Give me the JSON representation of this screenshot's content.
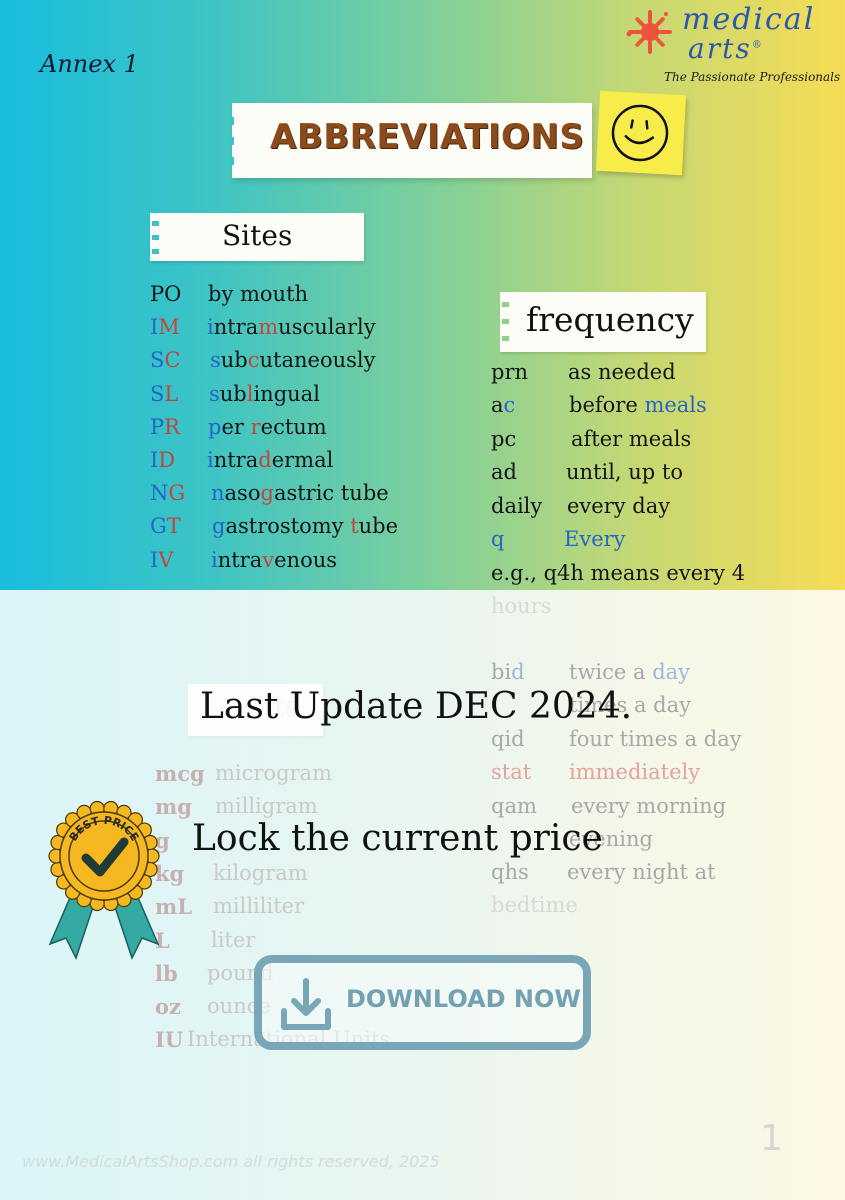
{
  "header": {
    "annex": "Annex 1",
    "title": "ABBREVIATIONS",
    "smiley_icon": "smiley-sticky-note"
  },
  "logo": {
    "line1": "medical",
    "line2": "arts",
    "registered": "®",
    "tagline": "The Passionate Professionals"
  },
  "sites": {
    "heading": "Sites",
    "items": [
      {
        "abbr": [
          [
            "PO",
            ""
          ]
        ],
        "def": [
          [
            "by mouth",
            ""
          ]
        ]
      },
      {
        "abbr": [
          [
            "I",
            "b"
          ],
          [
            "M",
            "r"
          ]
        ],
        "def": [
          [
            "i",
            "b"
          ],
          [
            "ntra",
            ""
          ],
          [
            "m",
            "r"
          ],
          [
            "uscularly",
            ""
          ]
        ]
      },
      {
        "abbr": [
          [
            "S",
            "b"
          ],
          [
            "C",
            "r"
          ]
        ],
        "def": [
          [
            "s",
            "b"
          ],
          [
            "ub",
            ""
          ],
          [
            "c",
            "r"
          ],
          [
            "utaneously",
            ""
          ]
        ]
      },
      {
        "abbr": [
          [
            "S",
            "b"
          ],
          [
            "L",
            "r"
          ]
        ],
        "def": [
          [
            "s",
            "b"
          ],
          [
            "ub",
            ""
          ],
          [
            "l",
            "r"
          ],
          [
            "ingual",
            ""
          ]
        ]
      },
      {
        "abbr": [
          [
            "P",
            "b"
          ],
          [
            "R",
            "r"
          ]
        ],
        "def": [
          [
            "p",
            "b"
          ],
          [
            "er ",
            ""
          ],
          [
            "r",
            "r"
          ],
          [
            "ectum",
            ""
          ]
        ]
      },
      {
        "abbr": [
          [
            "I",
            "b"
          ],
          [
            "D",
            "r"
          ]
        ],
        "def": [
          [
            "i",
            "b"
          ],
          [
            "ntra",
            ""
          ],
          [
            "d",
            "r"
          ],
          [
            "ermal",
            ""
          ]
        ]
      },
      {
        "abbr": [
          [
            "N",
            "b"
          ],
          [
            "G",
            "r"
          ]
        ],
        "def": [
          [
            "n",
            "b"
          ],
          [
            "aso",
            ""
          ],
          [
            "g",
            "r"
          ],
          [
            "astric tube",
            ""
          ]
        ]
      },
      {
        "abbr": [
          [
            "G",
            "b"
          ],
          [
            "T",
            "r"
          ]
        ],
        "def": [
          [
            "g",
            "b"
          ],
          [
            "astrostomy ",
            ""
          ],
          [
            "t",
            "r"
          ],
          [
            "ube",
            ""
          ]
        ]
      },
      {
        "abbr": [
          [
            "I",
            "b"
          ],
          [
            "V",
            "r"
          ]
        ],
        "def": [
          [
            "i",
            "b"
          ],
          [
            "ntra",
            ""
          ],
          [
            "v",
            "r"
          ],
          [
            "enous",
            ""
          ]
        ]
      }
    ]
  },
  "frequency": {
    "heading": "frequency",
    "items": [
      {
        "abbr": [
          [
            "prn",
            ""
          ]
        ],
        "def": [
          [
            "as needed",
            ""
          ]
        ]
      },
      {
        "abbr": [
          [
            "a",
            ""
          ],
          [
            "c",
            "b"
          ]
        ],
        "def": [
          [
            "before ",
            ""
          ],
          [
            "meals",
            "b"
          ]
        ]
      },
      {
        "abbr": [
          [
            "pc",
            ""
          ]
        ],
        "def": [
          [
            "after meals",
            ""
          ]
        ]
      },
      {
        "abbr": [
          [
            "ad",
            ""
          ]
        ],
        "def": [
          [
            "until, up to",
            ""
          ]
        ]
      },
      {
        "abbr": [
          [
            "daily",
            ""
          ]
        ],
        "def": [
          [
            "every day",
            ""
          ]
        ]
      },
      {
        "abbr": [
          [
            "q",
            "b"
          ]
        ],
        "def": [
          [
            "Every",
            "b"
          ]
        ]
      }
    ],
    "example_line1": "e.g., q4h means every 4",
    "example_line2": "hours",
    "faded_items": [
      {
        "abbr": [
          [
            "bi",
            ""
          ],
          [
            "d",
            "b"
          ]
        ],
        "def": [
          [
            "twice a ",
            ""
          ],
          [
            "day",
            "b"
          ]
        ]
      },
      {
        "abbr": [
          [
            "",
            ""
          ]
        ],
        "def": [
          [
            "times a day",
            ""
          ]
        ]
      },
      {
        "abbr": [
          [
            "qid",
            ""
          ]
        ],
        "def": [
          [
            "four times a day",
            ""
          ]
        ]
      },
      {
        "abbr": [
          [
            "stat",
            "r"
          ]
        ],
        "def": [
          [
            "immediately",
            "r"
          ]
        ]
      },
      {
        "abbr": [
          [
            "qam",
            ""
          ]
        ],
        "def": [
          [
            "every morning",
            ""
          ]
        ]
      },
      {
        "abbr": [
          [
            "",
            ""
          ]
        ],
        "def": [
          [
            "evening",
            ""
          ]
        ]
      },
      {
        "abbr": [
          [
            "qhs",
            ""
          ]
        ],
        "def": [
          [
            "every night at",
            ""
          ]
        ]
      }
    ],
    "faded_tail": "bedtime"
  },
  "units": {
    "heading_fragment": "ts",
    "faded_items": [
      {
        "abbr": "mcg",
        "def": "microgram"
      },
      {
        "abbr": "mg",
        "def": "milligram"
      },
      {
        "abbr": "g",
        "def": ""
      },
      {
        "abbr": "kg",
        "def": "kilogram"
      },
      {
        "abbr": "mL",
        "def": "milliliter"
      },
      {
        "abbr": "L",
        "def": "liter"
      },
      {
        "abbr": "lb",
        "def": "pound"
      },
      {
        "abbr": "oz",
        "def": "ounce"
      },
      {
        "abbr": "IU",
        "def": "International Units"
      }
    ]
  },
  "promo": {
    "last_update": "Last Update DEC 2024.",
    "lock_price": "Lock the current price",
    "badge_text": "BEST PRICE",
    "download_label": "DOWNLOAD NOW"
  },
  "footer": {
    "copyright": "www.MedicalArtsShop.com all rights reserved, 2025",
    "page_number": "1"
  },
  "colors": {
    "accent_blue": "#2466c6",
    "accent_red": "#c0463c",
    "button": "#7aa7b8",
    "badge_gold": "#f6b820",
    "ribbon_teal": "#35a9a4"
  }
}
